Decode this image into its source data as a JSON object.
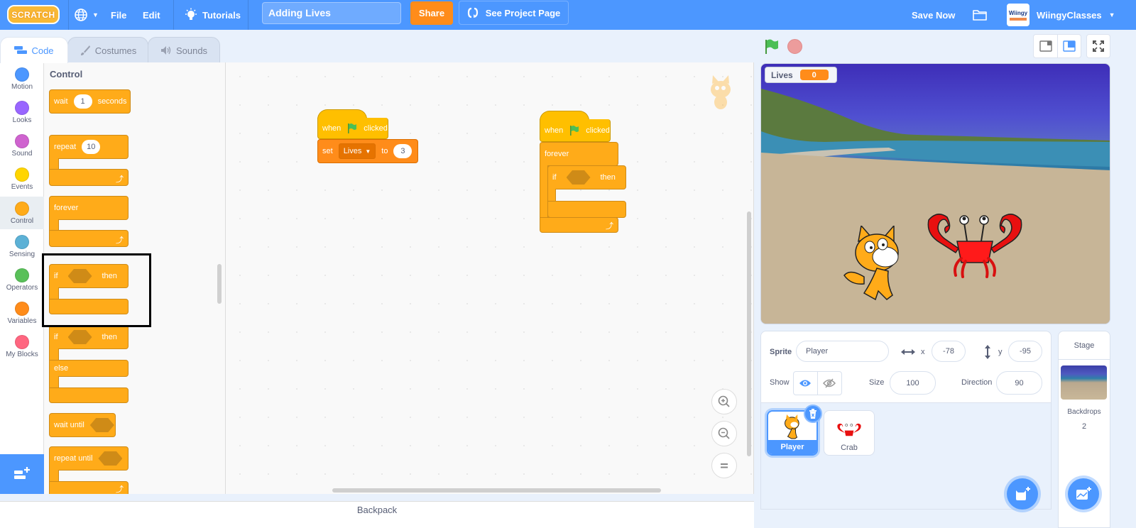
{
  "menubar": {
    "logo": "SCRATCH",
    "file": "File",
    "edit": "Edit",
    "tutorials": "Tutorials",
    "project_title": "Adding Lives",
    "share": "Share",
    "see_project_page": "See Project Page",
    "save_now": "Save Now",
    "username": "WiingyClasses",
    "avatar_text": "Wiingy"
  },
  "tabs": [
    {
      "label": "Code",
      "active": true
    },
    {
      "label": "Costumes",
      "active": false
    },
    {
      "label": "Sounds",
      "active": false
    }
  ],
  "categories": [
    {
      "label": "Motion",
      "color": "#4c97ff"
    },
    {
      "label": "Looks",
      "color": "#9966ff"
    },
    {
      "label": "Sound",
      "color": "#cf63cf"
    },
    {
      "label": "Events",
      "color": "#ffd500"
    },
    {
      "label": "Control",
      "color": "#ffab19"
    },
    {
      "label": "Sensing",
      "color": "#5cb1d6"
    },
    {
      "label": "Operators",
      "color": "#59c059"
    },
    {
      "label": "Variables",
      "color": "#ff8c1a"
    },
    {
      "label": "My Blocks",
      "color": "#ff6680"
    }
  ],
  "palette": {
    "title": "Control",
    "blocks": {
      "wait": {
        "label": "wait",
        "value": "1",
        "suffix": "seconds"
      },
      "repeat": {
        "label": "repeat",
        "value": "10"
      },
      "forever": {
        "label": "forever"
      },
      "if_then": {
        "label": "if",
        "suffix": "then"
      },
      "if_else": {
        "label": "if",
        "suffix": "then",
        "else": "else"
      },
      "wait_until": {
        "label": "wait until"
      },
      "repeat_until": {
        "label": "repeat until"
      }
    }
  },
  "workspace": {
    "script1": {
      "hat": {
        "when": "when",
        "clicked": "clicked"
      },
      "set": {
        "label": "set",
        "variable": "Lives",
        "to": "to",
        "value": "3"
      }
    },
    "script2": {
      "hat": {
        "when": "when",
        "clicked": "clicked"
      },
      "forever": "forever",
      "if": {
        "label": "if",
        "then": "then"
      }
    }
  },
  "backpack": "Backpack",
  "stage": {
    "monitor_label": "Lives",
    "monitor_value": "0"
  },
  "sprite_info": {
    "sprite_label": "Sprite",
    "sprite_name": "Player",
    "x_label": "x",
    "x": "-78",
    "y_label": "y",
    "y": "-95",
    "show_label": "Show",
    "size_label": "Size",
    "size": "100",
    "direction_label": "Direction",
    "direction": "90"
  },
  "sprites": [
    {
      "name": "Player",
      "selected": true
    },
    {
      "name": "Crab",
      "selected": false
    }
  ],
  "stage_pane": {
    "title": "Stage",
    "backdrops_label": "Backdrops",
    "backdrops_count": "2"
  }
}
